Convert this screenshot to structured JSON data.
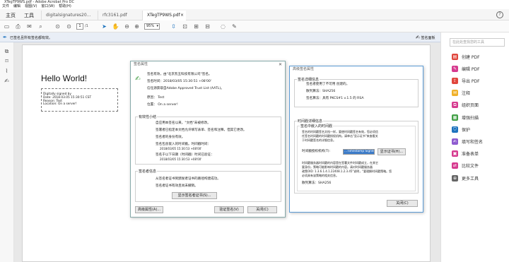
{
  "window": {
    "title": "XTegTP9WS.pdf - Adobe Acrobat Pro DC"
  },
  "menu": [
    "文件",
    "编辑",
    "视图(V)",
    "窗口(W)",
    "帮助(H)"
  ],
  "tabs": {
    "home": "主页",
    "tools": "工具",
    "docs": [
      "digitalsignatures20...",
      "rfc3161.pdf",
      "XTegTP9WS.pdf"
    ]
  },
  "toolbar": {
    "page_current": "1",
    "page_total": "/1",
    "zoom": "95%"
  },
  "sigbar": {
    "message": "已签名且所有签名都有效。",
    "panel_label": "签名面板"
  },
  "document": {
    "heading": "Hello World!",
    "stamp": [
      "Digitally signed by",
      "Date: 2018.03.05 15:30:51 CST",
      "Reason: Test",
      "Location: On a server!"
    ]
  },
  "right_pane": {
    "search_placeholder": "在此处查找您的工具",
    "items": [
      "创建 PDF",
      "编辑 PDF",
      "导出 PDF",
      "注释",
      "组织页面",
      "增强扫描",
      "保护",
      "填写和签名",
      "准备表单",
      "比较文件",
      "更多工具"
    ],
    "colors": [
      "#e0463c",
      "#d63b8f",
      "#e0463c",
      "#f0b12a",
      "#d63b8f",
      "#43a047",
      "#1e73be",
      "#8e5bd0",
      "#d63b8f",
      "#d63b8f",
      "#666666"
    ],
    "icons": [
      "create-pdf-icon",
      "edit-pdf-icon",
      "export-pdf-icon",
      "comment-icon",
      "organize-pages-icon",
      "enhance-scan-icon",
      "protect-icon",
      "fill-sign-icon",
      "prepare-form-icon",
      "compare-files-icon",
      "more-tools-icon"
    ]
  },
  "dialog1": {
    "title": "签名属性",
    "l1": "签名有效，由\"北京凯玉科技有限公司\"签名。",
    "l2": "签名时间：2018/03/05 15:30:51 +08'00'",
    "l3": "信任源获取自Adobe Approved Trust List (AATL)。",
    "l4": "原因： Test",
    "l5": "位置： On a server!",
    "validity_legend": "有效性小结",
    "v1": "自应用本签名以来，\"文档\"未被修改。",
    "v2": "签署者已指定本文档允许填写表单、签名和注释，但其它更改。",
    "v3": "签名者的身份有效。",
    "v4": "签名包含嵌入的时间戳。时间戳时间：",
    "v4b": "2018/03/05 15:30:53 +08'00'",
    "v5": "签名于以下日期（时间戳）时间已验证：",
    "v5b": "2018/03/05 15:30:53 +08'00'",
    "signer_legend": "签名者信息",
    "s1": "从签名者证书到颁发者证书的路径构建成功。",
    "s2": "签名者证书有效且尚未撤销。",
    "btn_cert": "显示签名者证书(S)...",
    "btn_adv": "高级属性(A)...",
    "btn_verify": "验证签名(V)",
    "btn_close": "关闭(C)"
  },
  "dialog2": {
    "title": "高级签名属性",
    "detail_legend": "签名详细信息",
    "d1": "签名者使用了不可用 创建的。",
    "d2": "散列算法：SHA256",
    "d3": "签名算法：具有 PKCS#1 v.1.5 的 RSA",
    "ts_legend": "时间戳详细信息",
    "ts_sub": "签名中嵌入的时间戳",
    "t1": "签名的时间戳签名文档一样，要使时间戳签名有效，您必须信",
    "t2": "任签名时间戳的时间戳授权机构。请单击\"显示证书\"来查看关",
    "t3": "于时间戳签名的详细信息。",
    "tsa_label": "时间戳授权机构(T):",
    "tsa_value": "...Timestamp Signer",
    "btn_show_cert": "显示证书(H)...",
    "p1": "时间戳服务器时间戳的内容是在签署文件时间戳成立，在其它",
    "p2": "要身份，策略可能影响时间戳的内容。请对时间戳服务器",
    "p3": "政策OID: 1.3.6.1.4.1.22408.1.2.3.45\"说明，\"要理解时间戳策略。您",
    "p4": "必须具有该策略的相关信息。",
    "hash": "散列算法：SHA256",
    "btn_close": "关闭(C)"
  }
}
